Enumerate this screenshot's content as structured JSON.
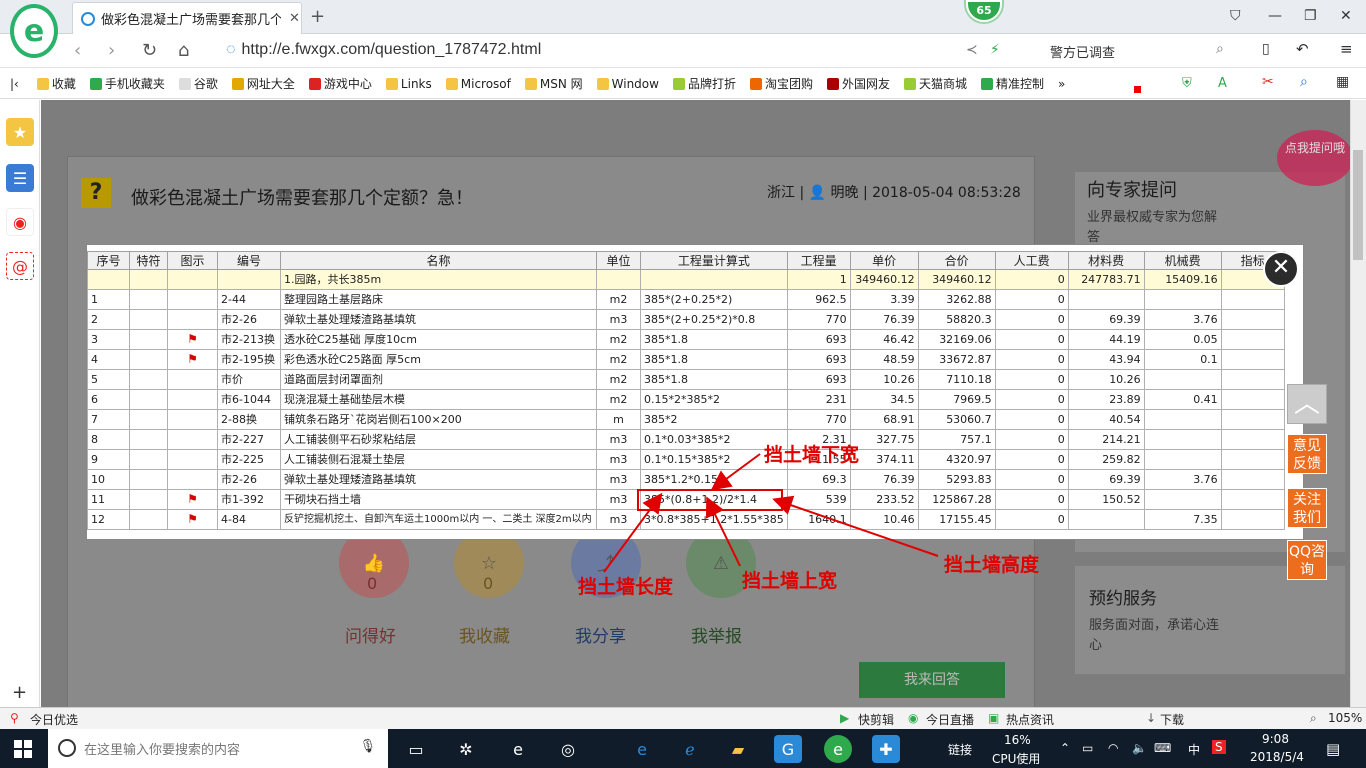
{
  "browser": {
    "tab_title": "做彩色混凝土广场需要套那几个定",
    "badge": "65",
    "url": "http://e.fwxgx.com/question_1787472.html",
    "search_text": "警方已调查"
  },
  "bookmarks": [
    "收藏",
    "手机收藏夹",
    "谷歌",
    "网址大全",
    "游戏中心",
    "Links",
    "Microsof",
    "MSN 网",
    "Window",
    "品牌打折",
    "淘宝团购",
    "外国网友",
    "天猫商城",
    "精准控制"
  ],
  "page": {
    "question_title": "做彩色混凝土广场需要套那几个定额？急！",
    "question_meta": "浙江 | 👤 明晚 | 2018-05-04 08:53:28",
    "expert_title": "向专家提问",
    "expert_sub": "业界最权威专家为您解答",
    "speech": "点我提问哦",
    "service_title": "预约服务",
    "service_sub": "服务面对面，承诺心连心",
    "actions": [
      {
        "icon": "👍",
        "count": "0",
        "label": "问得好"
      },
      {
        "icon": "☆",
        "count": "0",
        "label": "我收藏"
      },
      {
        "icon": "⤴",
        "count": "",
        "label": "我分享"
      },
      {
        "icon": "⚠",
        "count": "",
        "label": "我举报"
      }
    ],
    "answer_btn": "我来回答"
  },
  "sheet": {
    "headers": [
      "序号",
      "特符",
      "图示",
      "编号",
      "名称",
      "单位",
      "工程量计算式",
      "工程量",
      "单价",
      "合价",
      "人工费",
      "材料费",
      "机械费",
      "指标"
    ],
    "rows": [
      {
        "no": "",
        "tf": "",
        "flag": "",
        "code": "",
        "name": "1.园路，共长385m",
        "unit": "",
        "formula": "",
        "qty": "1",
        "price": "349460.12",
        "total": "349460.12",
        "labor": "0",
        "mat": "247783.71",
        "mach": "15409.16",
        "hl": true
      },
      {
        "no": "1",
        "tf": "",
        "flag": "",
        "code": "2-44",
        "name": "整理园路土基层路床",
        "unit": "m2",
        "formula": "385*(2+0.25*2)",
        "qty": "962.5",
        "price": "3.39",
        "total": "3262.88",
        "labor": "0",
        "mat": "",
        "mach": ""
      },
      {
        "no": "2",
        "tf": "",
        "flag": "",
        "code": "市2-26",
        "name": "弹软土基处理矮渣路基填筑",
        "unit": "m3",
        "formula": "385*(2+0.25*2)*0.8",
        "qty": "770",
        "price": "76.39",
        "total": "58820.3",
        "labor": "0",
        "mat": "69.39",
        "mach": "3.76"
      },
      {
        "no": "3",
        "tf": "",
        "flag": "⚑",
        "code": "市2-213换",
        "name": "透水砼C25基础 厚度10cm",
        "unit": "m2",
        "formula": "385*1.8",
        "qty": "693",
        "price": "46.42",
        "total": "32169.06",
        "labor": "0",
        "mat": "44.19",
        "mach": "0.05"
      },
      {
        "no": "4",
        "tf": "",
        "flag": "⚑",
        "code": "市2-195换",
        "name": "彩色透水砼C25路面 厚5cm",
        "unit": "m2",
        "formula": "385*1.8",
        "qty": "693",
        "price": "48.59",
        "total": "33672.87",
        "labor": "0",
        "mat": "43.94",
        "mach": "0.1"
      },
      {
        "no": "5",
        "tf": "",
        "flag": "",
        "code": "市价",
        "name": "道路面层封闭罩面剂",
        "unit": "m2",
        "formula": "385*1.8",
        "qty": "693",
        "price": "10.26",
        "total": "7110.18",
        "labor": "0",
        "mat": "10.26",
        "mach": ""
      },
      {
        "no": "6",
        "tf": "",
        "flag": "",
        "code": "市6-1044",
        "name": "现浇混凝土基础垫层木模",
        "unit": "m2",
        "formula": "0.15*2*385*2",
        "qty": "231",
        "price": "34.5",
        "total": "7969.5",
        "labor": "0",
        "mat": "23.89",
        "mach": "0.41"
      },
      {
        "no": "7",
        "tf": "",
        "flag": "",
        "code": "2-88换",
        "name": "铺筑条石路牙`花岗岩侧石100×200",
        "unit": "m",
        "formula": "385*2",
        "qty": "770",
        "price": "68.91",
        "total": "53060.7",
        "labor": "0",
        "mat": "40.54",
        "mach": ""
      },
      {
        "no": "8",
        "tf": "",
        "flag": "",
        "code": "市2-227",
        "name": "人工铺装侧平石砂浆粘结层",
        "unit": "m3",
        "formula": "0.1*0.03*385*2",
        "qty": "2.31",
        "price": "327.75",
        "total": "757.1",
        "labor": "0",
        "mat": "214.21",
        "mach": ""
      },
      {
        "no": "9",
        "tf": "",
        "flag": "",
        "code": "市2-225",
        "name": "人工铺装侧石混凝土垫层",
        "unit": "m3",
        "formula": "0.1*0.15*385*2",
        "qty": "11.55",
        "price": "374.11",
        "total": "4320.97",
        "labor": "0",
        "mat": "259.82",
        "mach": ""
      },
      {
        "no": "10",
        "tf": "",
        "flag": "",
        "code": "市2-26",
        "name": "弹软土基处理矮渣路基填筑",
        "unit": "m3",
        "formula": "385*1.2*0.15",
        "qty": "69.3",
        "price": "76.39",
        "total": "5293.83",
        "labor": "0",
        "mat": "69.39",
        "mach": "3.76"
      },
      {
        "no": "11",
        "tf": "",
        "flag": "⚑",
        "code": "市1-392",
        "name": "干砌块石挡土墙",
        "unit": "m3",
        "formula": "385*(0.8+1.2)/2*1.4",
        "qty": "539",
        "price": "233.52",
        "total": "125867.28",
        "labor": "0",
        "mat": "150.52",
        "mach": ""
      },
      {
        "no": "12",
        "tf": "",
        "flag": "⚑",
        "code": "4-84",
        "name": "反铲挖掘机挖土、自卸汽车运土1000m以内 一、二类土 深度2m以内",
        "unit": "m3",
        "formula": "3*0.8*385+1.2*1.55*385",
        "qty": "1640.1",
        "price": "10.46",
        "total": "17155.45",
        "labor": "0",
        "mat": "",
        "mach": "7.35"
      }
    ]
  },
  "annotations": {
    "bottom_width": "挡土墙下宽",
    "top_width": "挡土墙上宽",
    "length": "挡土墙长度",
    "height": "挡土墙高度",
    "color": "#e00000"
  },
  "float_buttons": [
    "意见反馈",
    "关注我们",
    "QQ咨询"
  ],
  "statusbar": {
    "left": "今日优选",
    "items": [
      "快剪辑",
      "今日直播",
      "热点资讯",
      "下载"
    ],
    "zoom": "105%"
  },
  "taskbar": {
    "search_placeholder": "在这里输入你要搜索的内容",
    "cpu": "16%",
    "cpu_label": "CPU使用",
    "link": "链接",
    "ime": "中",
    "time": "9:08",
    "date": "2018/5/4"
  }
}
